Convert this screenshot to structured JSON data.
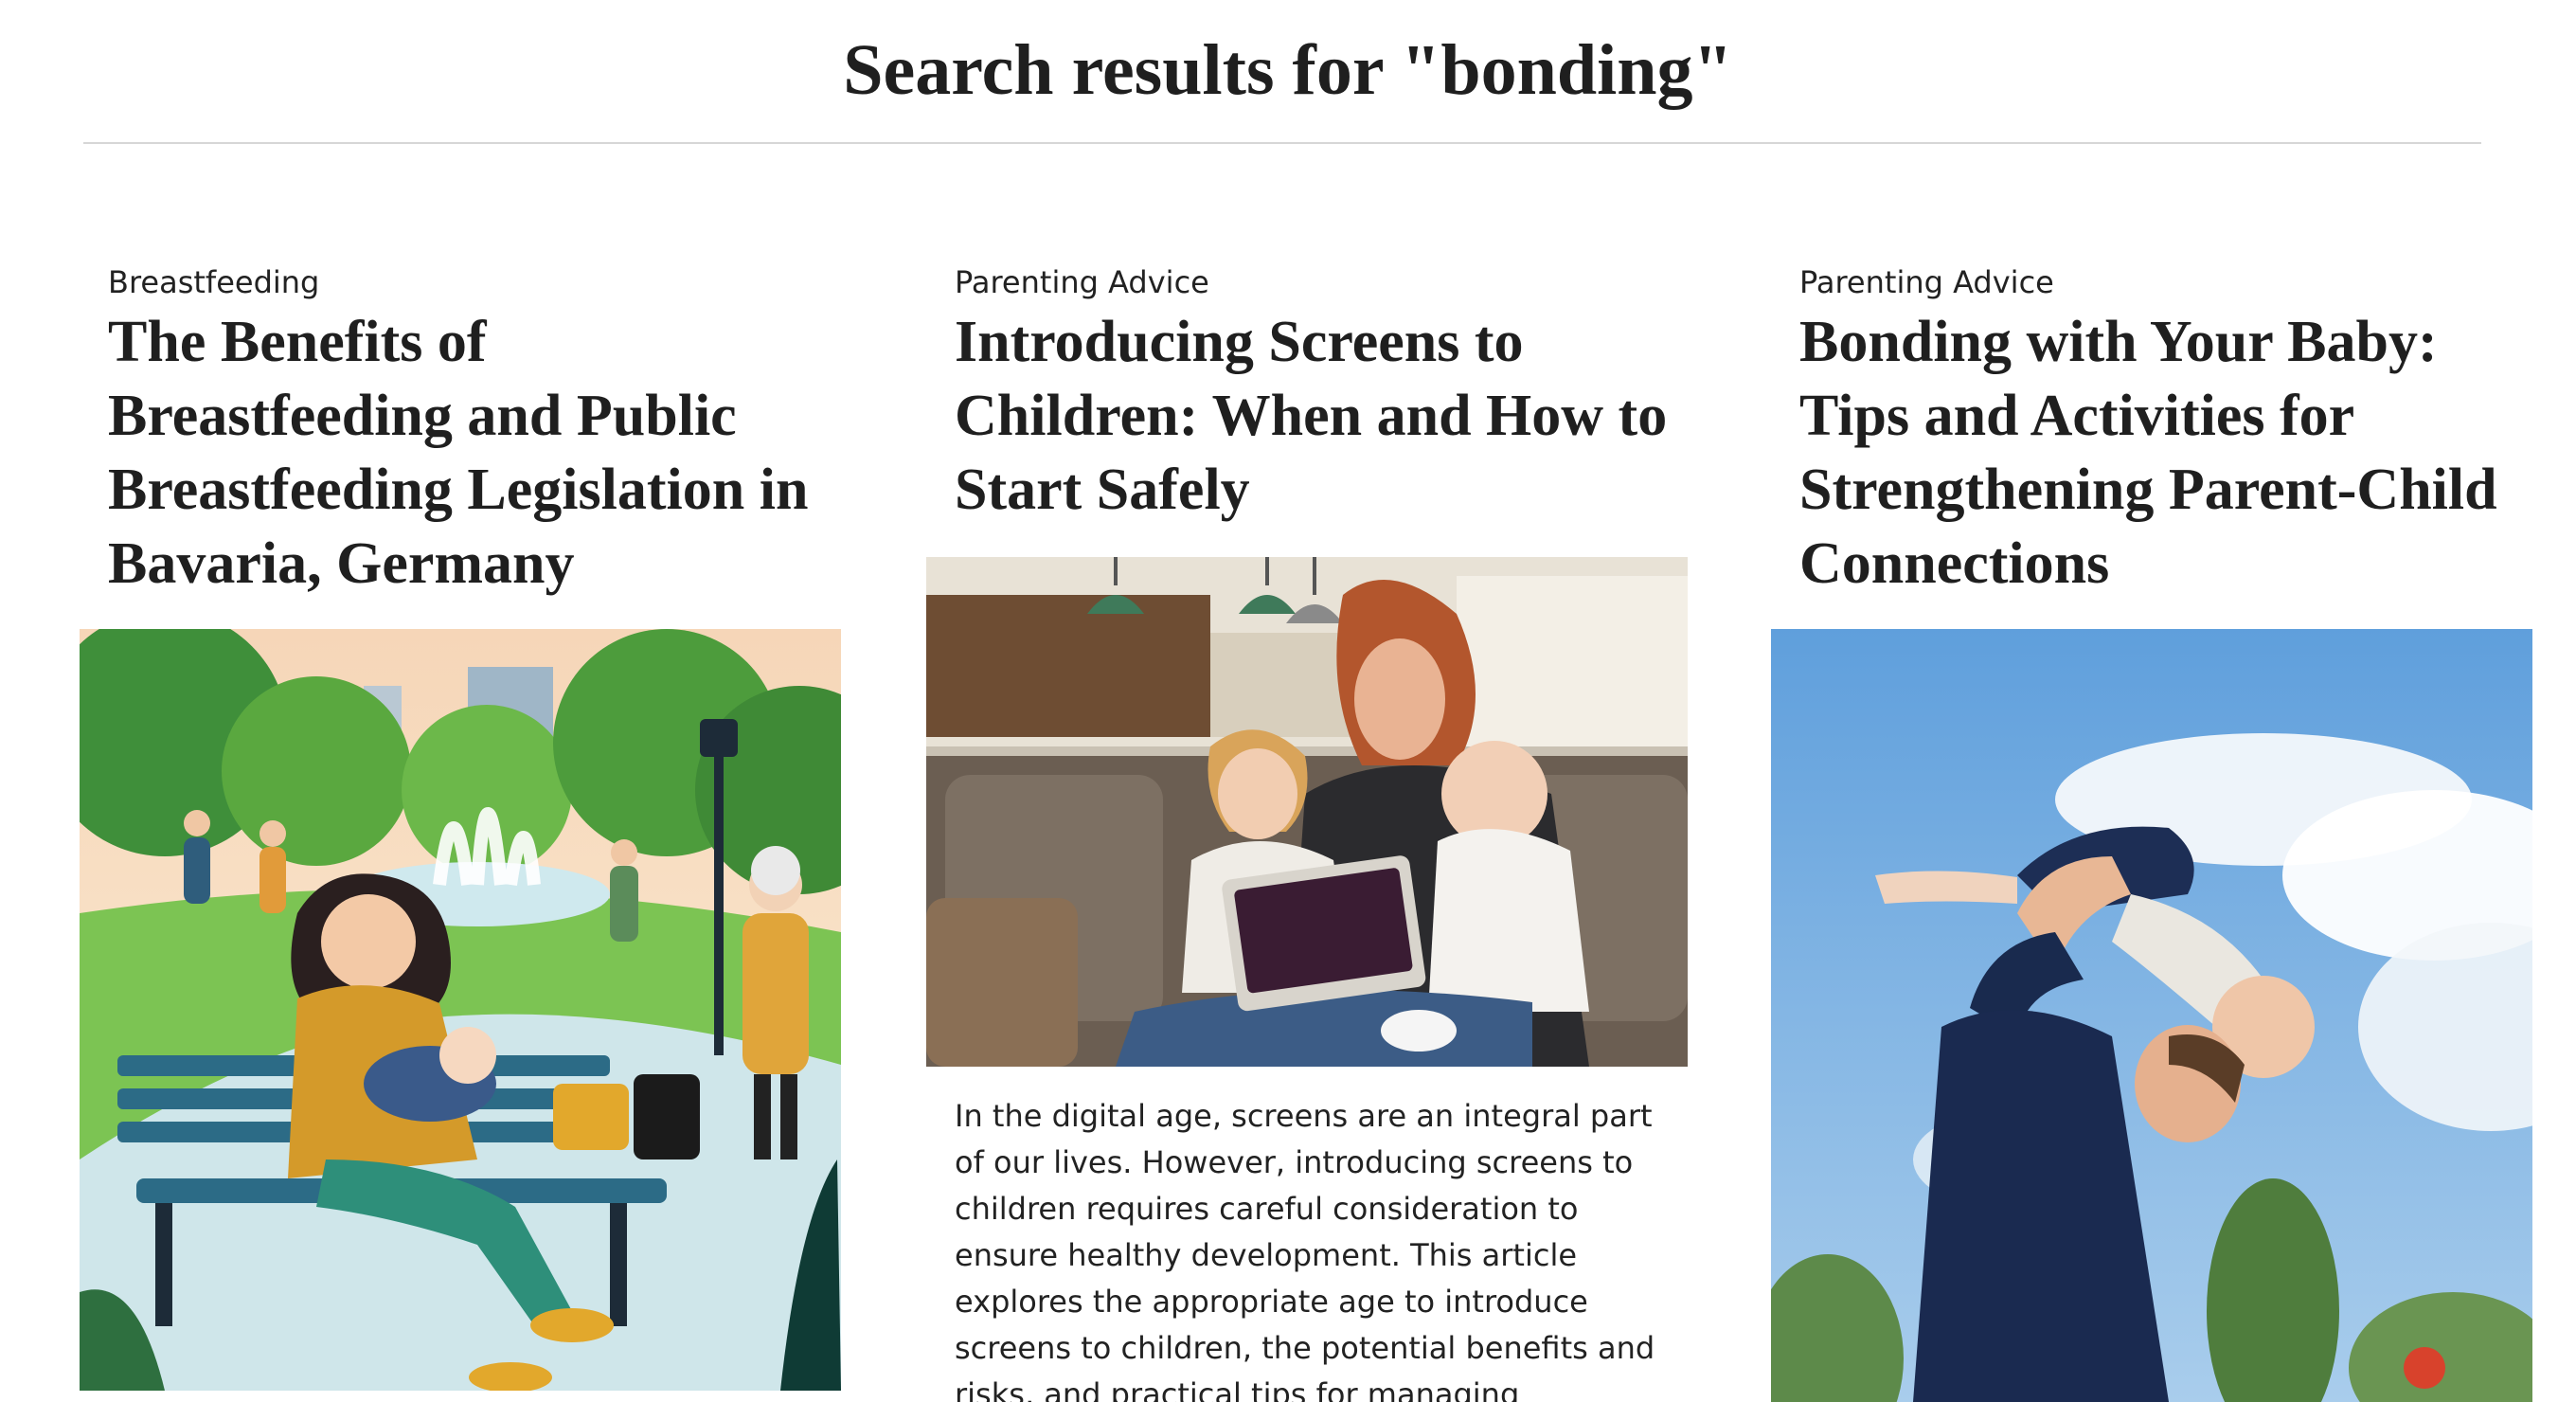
{
  "page": {
    "title": "Search results for \"bonding\""
  },
  "results": [
    {
      "category": "Breastfeeding",
      "title": "The Benefits of Breastfeeding and Public Breastfeeding Legislation in Bavaria, Germany",
      "image_alt": "Illustration of a mother breastfeeding her baby on a park bench in a busy park with a fountain"
    },
    {
      "category": "Parenting Advice",
      "title": "Introducing Screens to Children: When and How to Start Safely",
      "image_alt": "Mother on a sofa holding a baby while a toddler looks at a tablet",
      "excerpt": "In the digital age, screens are an integral part of our lives. However, introducing screens to children requires careful consideration to ensure healthy development. This article explores the appropriate age to introduce screens to children, the potential benefits and risks, and practical tips for managing"
    },
    {
      "category": "Parenting Advice",
      "title": "Bonding with Your Baby: Tips and Activities for Strengthening Parent-Child Connections",
      "image_alt": "Father lifting his baby into the air against a blue sky"
    }
  ]
}
